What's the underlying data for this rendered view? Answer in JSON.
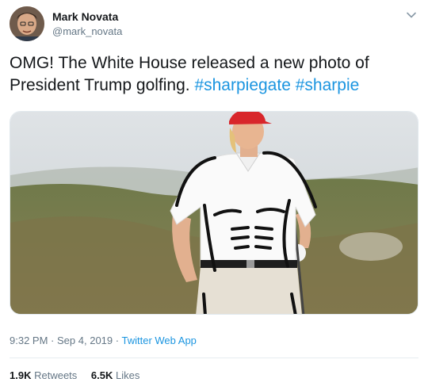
{
  "author": {
    "name": "Mark Novata",
    "handle": "@mark_novata"
  },
  "tweet": {
    "text_before": "OMG! The White House released a new photo of President Trump golfing. ",
    "hashtags": [
      "#sharpiegate",
      "#sharpie"
    ]
  },
  "media": {
    "alt": "Photo of a golfer in a white polo shirt and red cap with a sharpie-drawn muscular torso"
  },
  "meta": {
    "time": "9:32 PM",
    "separator": "·",
    "date": "Sep 4, 2019",
    "app": "Twitter Web App"
  },
  "stats": {
    "retweets_count": "1.9K",
    "retweets_label": "Retweets",
    "likes_count": "6.5K",
    "likes_label": "Likes"
  },
  "colors": {
    "link": "#1b95e0",
    "secondary_text": "#657786",
    "cap": "#d8262b"
  }
}
